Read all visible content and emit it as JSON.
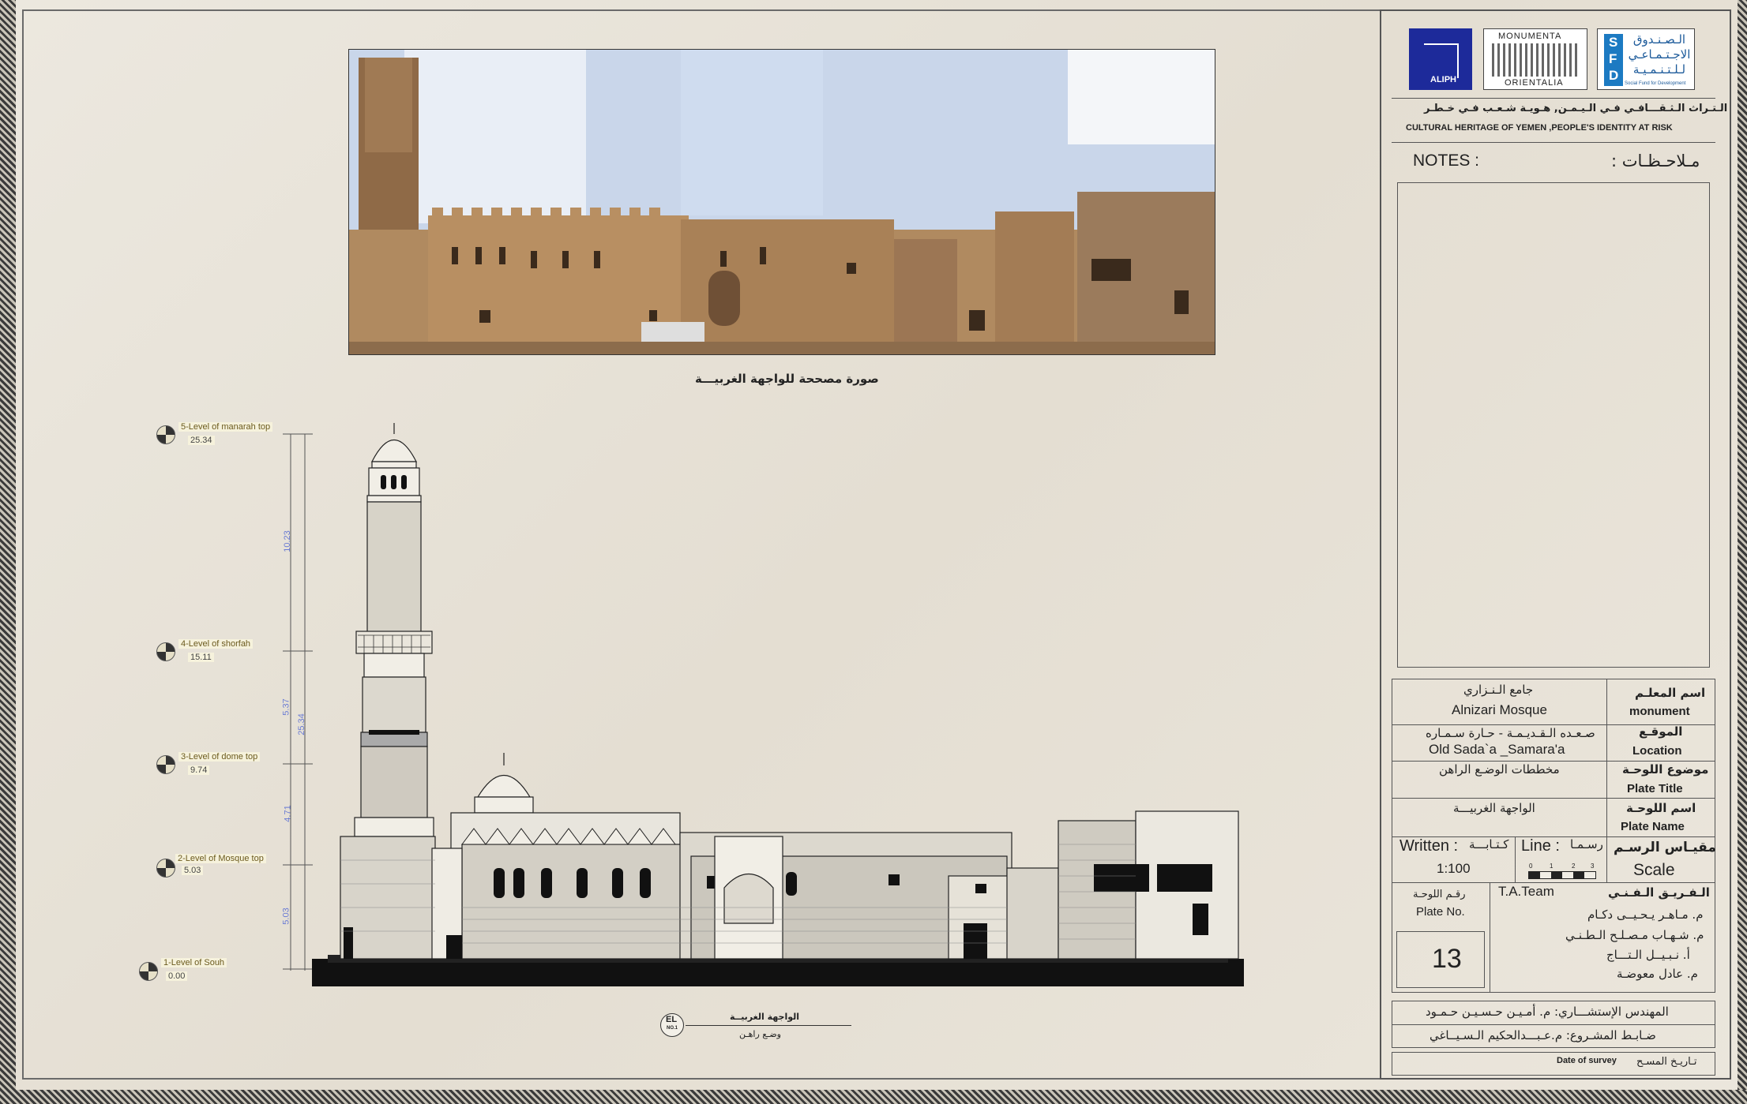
{
  "photo": {
    "caption": "صورة مصححة للواجهة الغربيـــة"
  },
  "elevation": {
    "levels": [
      {
        "label": "5-Level of manarah top",
        "value": "25.34"
      },
      {
        "label": "4-Level of shorfah",
        "value": "15.11"
      },
      {
        "label": "3-Level of dome top",
        "value": "9.74"
      },
      {
        "label": "2-Level of Mosque top",
        "value": "5.03"
      },
      {
        "label": "1-Level of Souh",
        "value": "0.00"
      }
    ],
    "dimensions": {
      "d1": "10.23",
      "d2": "5.37",
      "d3": "4.71",
      "d4": "5.03",
      "total": "25.34"
    },
    "tag": {
      "code": "EL",
      "number": "NO.1",
      "title": "الواجهة الغربيــة",
      "subtitle": "وضـع راهـن"
    }
  },
  "logos": {
    "aliph": "ALIPH",
    "monumenta_top": "MONUMENTA",
    "monumenta_bottom": "ORIENTALIA",
    "sfd_letters": [
      "S",
      "F",
      "D"
    ],
    "sfd_arabic": "الـصـنـدوق الاجـتـمـاعـي لـلـتـنـمـيـة",
    "sfd_english": "Social Fund for Development"
  },
  "project": {
    "title_ar": "الـتـراث الـثـقـــافـي فـي الـيـمـن, هـويـة شـعـب فـي خـطـر",
    "title_en": "CULTURAL HERITAGE OF YEMEN ,PEOPLE'S IDENTITY AT RISK"
  },
  "notes": {
    "label_en": "NOTES :",
    "label_ar": "مـلاحـظـات :"
  },
  "info": {
    "monument": {
      "value_ar": "جامع الـنـزاري",
      "value_en": "Alnizari Mosque",
      "label_ar": "اسم المعلـم",
      "label_en": "monument"
    },
    "location": {
      "value_ar": "صـعـده الـقـديـمـة - حـارة سـمـاره",
      "value_en": "Old Sada`a  _Samara'a",
      "label_ar": "الموقـع",
      "label_en": "Location"
    },
    "plate_title": {
      "value_ar": "مخططات الوضـع الراهن",
      "label_ar": "موضوع اللوحـة",
      "label_en": "Plate Title"
    },
    "plate_name": {
      "value_ar": "الواجهة الغربيـــة",
      "label_ar": "اسم اللوحـة",
      "label_en": "Plate Name"
    }
  },
  "scale": {
    "written_en": "Written :",
    "written_ar": "كـتـابـــة",
    "written_value": "1:100",
    "line_en": "Line :",
    "line_ar": "رسـمـا",
    "bar_ticks": [
      "0",
      "1",
      "2",
      "3"
    ],
    "label_ar": "مقيـاس الرسـم",
    "label_en": "Scale"
  },
  "plate": {
    "label_ar": "رقـم اللوحـة",
    "label_en": "Plate No.",
    "number": "13"
  },
  "team": {
    "label_en": "T.A.Team",
    "label_ar": "الـفـريـق الـفـنـي",
    "members": [
      "م. مـاهـر يـحـيــى دكـام",
      "م. شـهـاب مـصـلـح الـطـنـي",
      "أ. نـبـيــل الـتـــاج",
      "م. عادل معوضـة"
    ]
  },
  "consultant": {
    "engineer": "المهندس الإستشـــاري: م. أمـيـن حـسـيـن حـمـود",
    "controller": "ضـابـط المشـروع: م.عـبـــدالحكيم الـسـيــاغي"
  },
  "survey": {
    "label_en": "Date of survey",
    "label_ar": "تـاريـخ المسـح"
  }
}
